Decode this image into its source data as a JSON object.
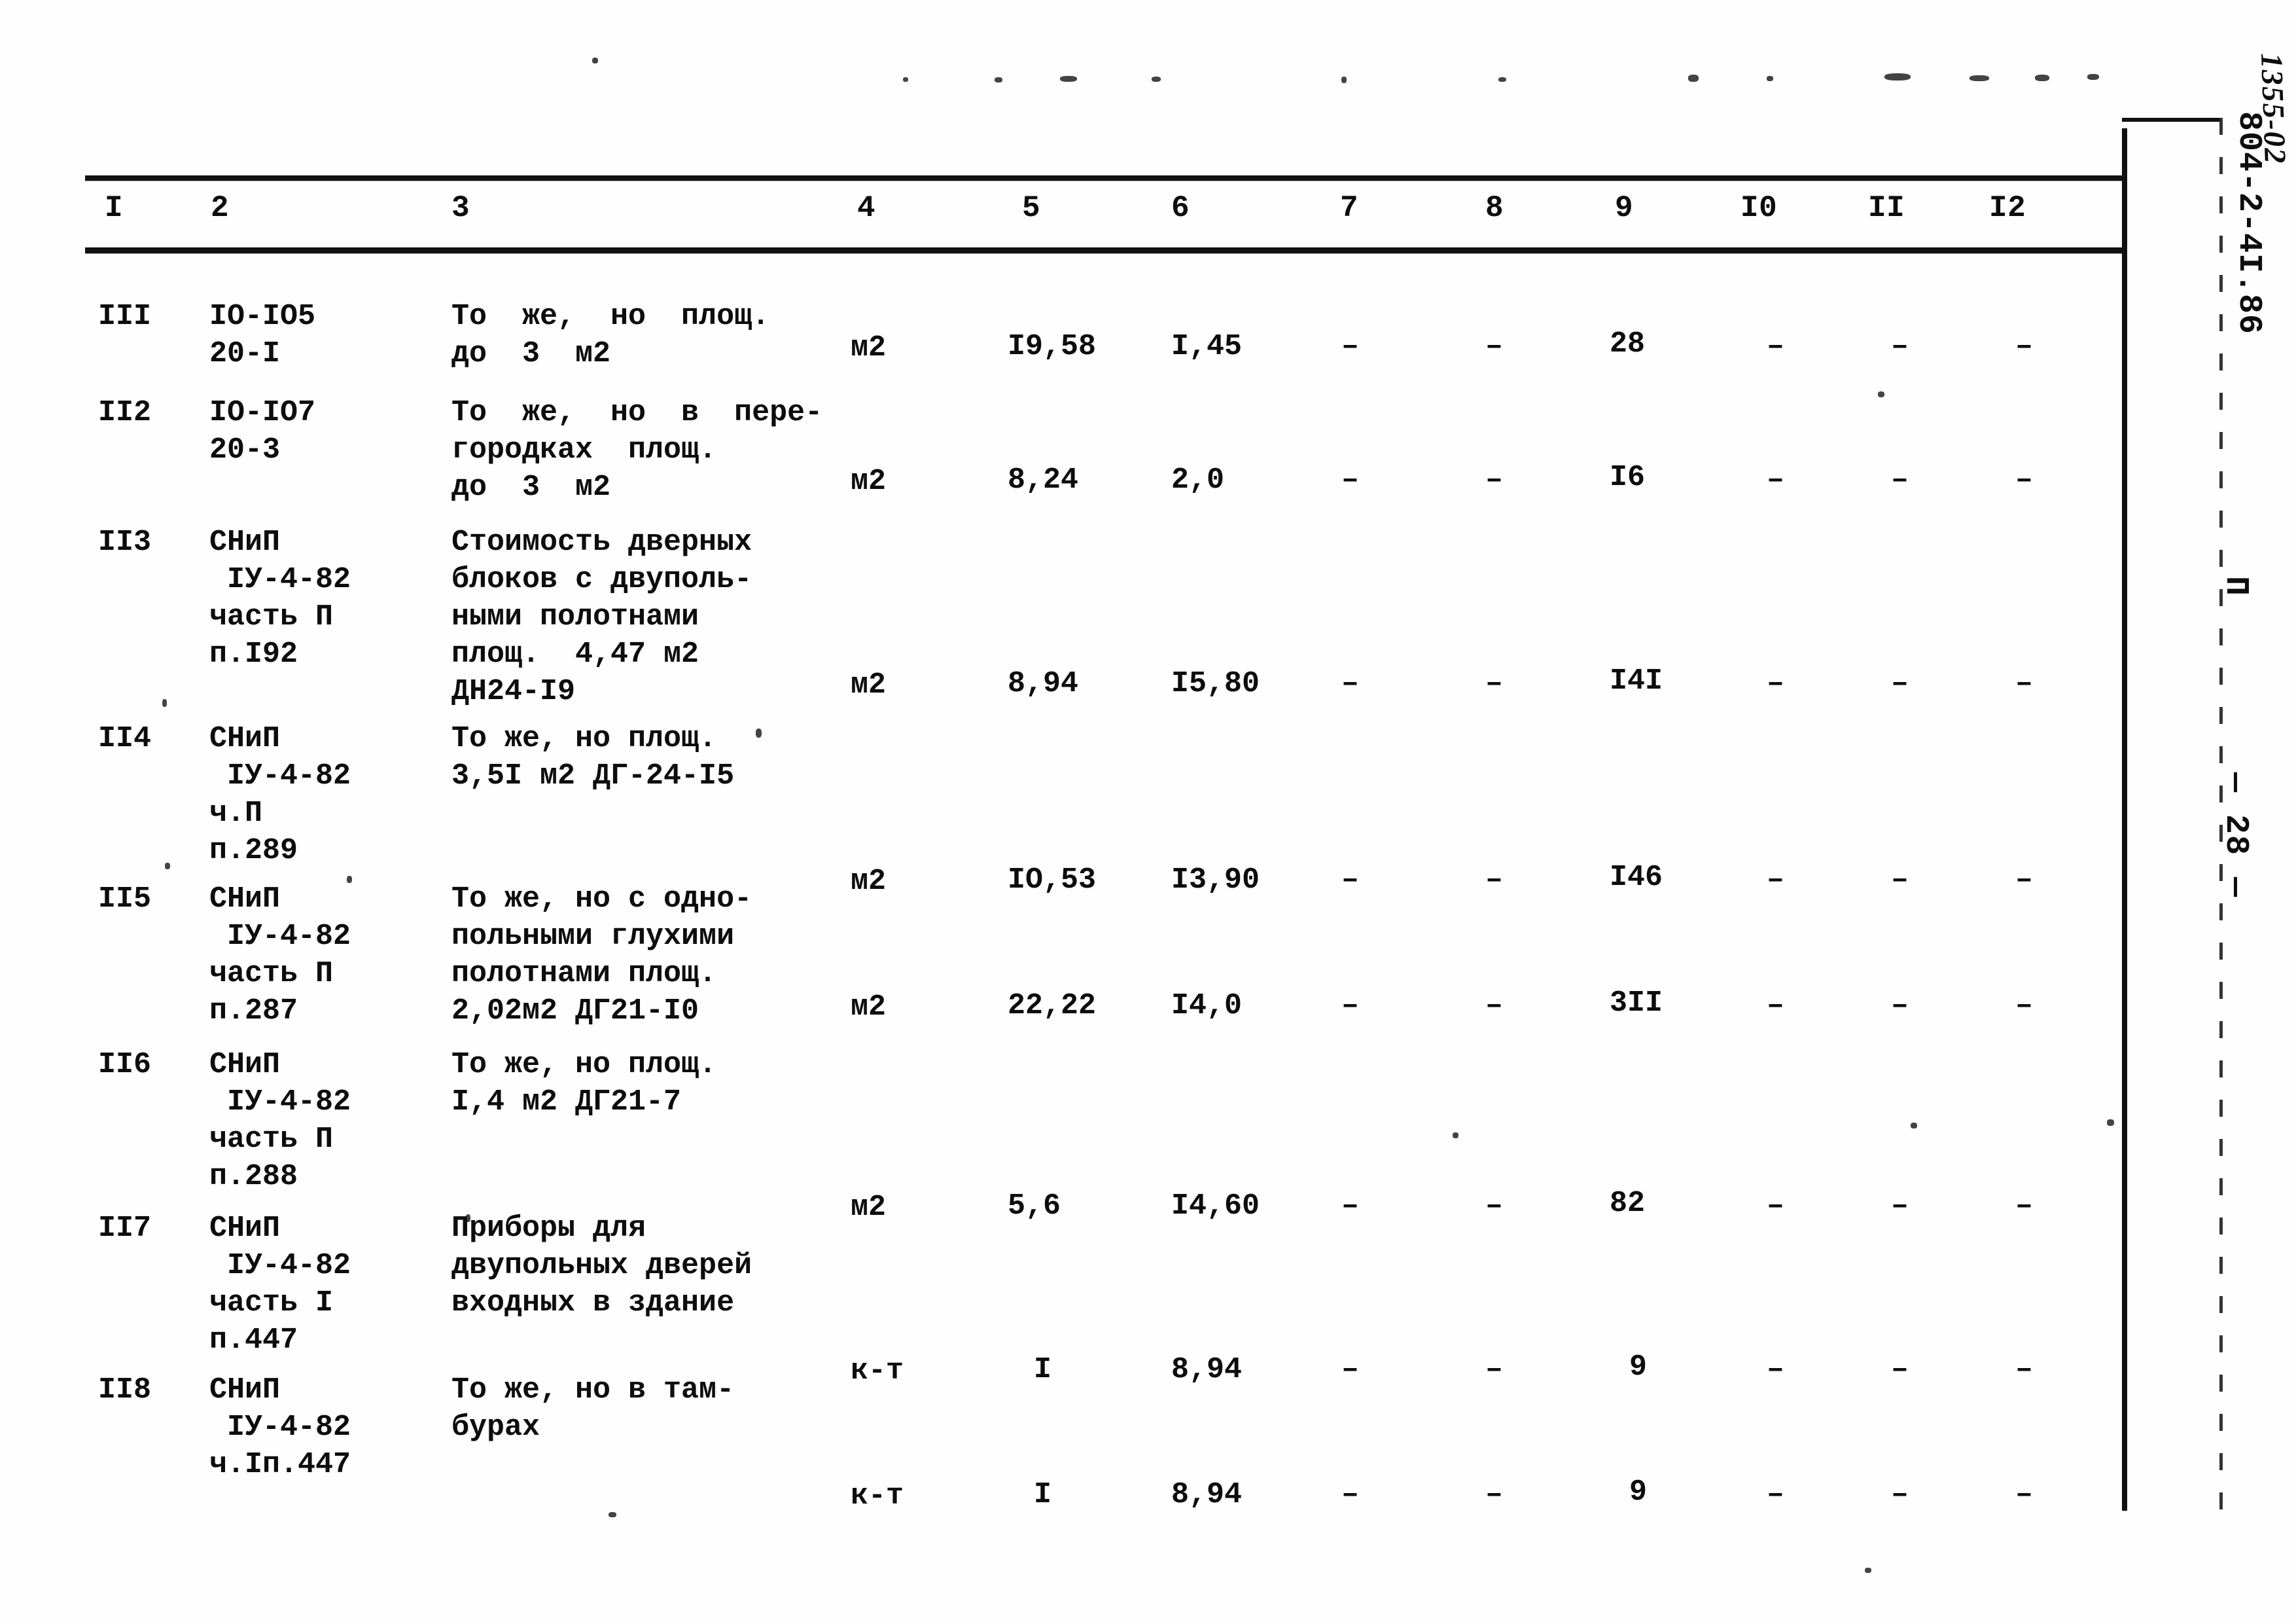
{
  "document": {
    "column_headers": [
      "I",
      "2",
      "3",
      "4",
      "5",
      "6",
      "7",
      "8",
      "9",
      "I0",
      "II",
      "I2"
    ],
    "margin": {
      "handwritten_code": "1355-02",
      "document_code": "804-2-4I.86",
      "part_mark": "П",
      "page_number": "— 28 —"
    },
    "rows": [
      {
        "c1": "III",
        "c2": "IO-IO5\n20-I",
        "c3": "То  же,  но  площ.\nдо  3  м2",
        "c4": "м2",
        "c5": "I9,58",
        "c6": "I,45",
        "c7": "–",
        "c8": "–",
        "c9": "28",
        "c10": "–",
        "c11": "–",
        "c12": "–"
      },
      {
        "c1": "II2",
        "c2": "IO-IO7\n20-3",
        "c3": "То  же,  но  в  пере-\nгородках  площ.\nдо  3  м2",
        "c4": "м2",
        "c5": "8,24",
        "c6": "2,0",
        "c7": "–",
        "c8": "–",
        "c9": "I6",
        "c10": "–",
        "c11": "–",
        "c12": "–"
      },
      {
        "c1": "II3",
        "c2": "СНиП\n IУ-4-82\nчасть П\nп.I92",
        "c3": "Стоимость дверных\nблоков с двуполь-\nными полотнами\nплощ.  4,47 м2\nДН24-I9",
        "c4": "м2",
        "c5": "8,94",
        "c6": "I5,80",
        "c7": "–",
        "c8": "–",
        "c9": "I4I",
        "c10": "–",
        "c11": "–",
        "c12": "–"
      },
      {
        "c1": "II4",
        "c2": "СНиП\n IУ-4-82\nч.П\nп.289",
        "c3": "То же, но площ.\n3,5I м2 ДГ-24-I5",
        "c4": "м2",
        "c5": "IO,53",
        "c6": "I3,90",
        "c7": "–",
        "c8": "–",
        "c9": "I46",
        "c10": "–",
        "c11": "–",
        "c12": "–"
      },
      {
        "c1": "II5",
        "c2": "СНиП\n IУ-4-82\nчасть П\nп.287",
        "c3": "То же, но с одно-\nпольными глухими\nполотнами площ.\n2,02м2 ДГ21-I0",
        "c4": "м2",
        "c5": "22,22",
        "c6": "I4,0",
        "c7": "–",
        "c8": "–",
        "c9": "3II",
        "c10": "–",
        "c11": "–",
        "c12": "–"
      },
      {
        "c1": "II6",
        "c2": "СНиП\n IУ-4-82\nчасть П\nп.288",
        "c3": "То же, но площ.\nI,4 м2 ДГ21-7",
        "c4": "м2",
        "c5": "5,6",
        "c6": "I4,60",
        "c7": "–",
        "c8": "–",
        "c9": "82",
        "c10": "–",
        "c11": "–",
        "c12": "–"
      },
      {
        "c1": "II7",
        "c2": "СНиП\n IУ-4-82\nчасть I\nп.447",
        "c3": "Приборы для\nдвупольных дверей\nвходных в здание",
        "c4": "к-т",
        "c5": "I",
        "c6": "8,94",
        "c7": "–",
        "c8": "–",
        "c9": "9",
        "c10": "–",
        "c11": "–",
        "c12": "–"
      },
      {
        "c1": "II8",
        "c2": "СНиП\n IУ-4-82\nч.Iп.447",
        "c3": "То же, но в там-\nбурах",
        "c4": "к-т",
        "c5": "I",
        "c6": "8,94",
        "c7": "–",
        "c8": "–",
        "c9": "9",
        "c10": "–",
        "c11": "–",
        "c12": "–"
      }
    ]
  }
}
